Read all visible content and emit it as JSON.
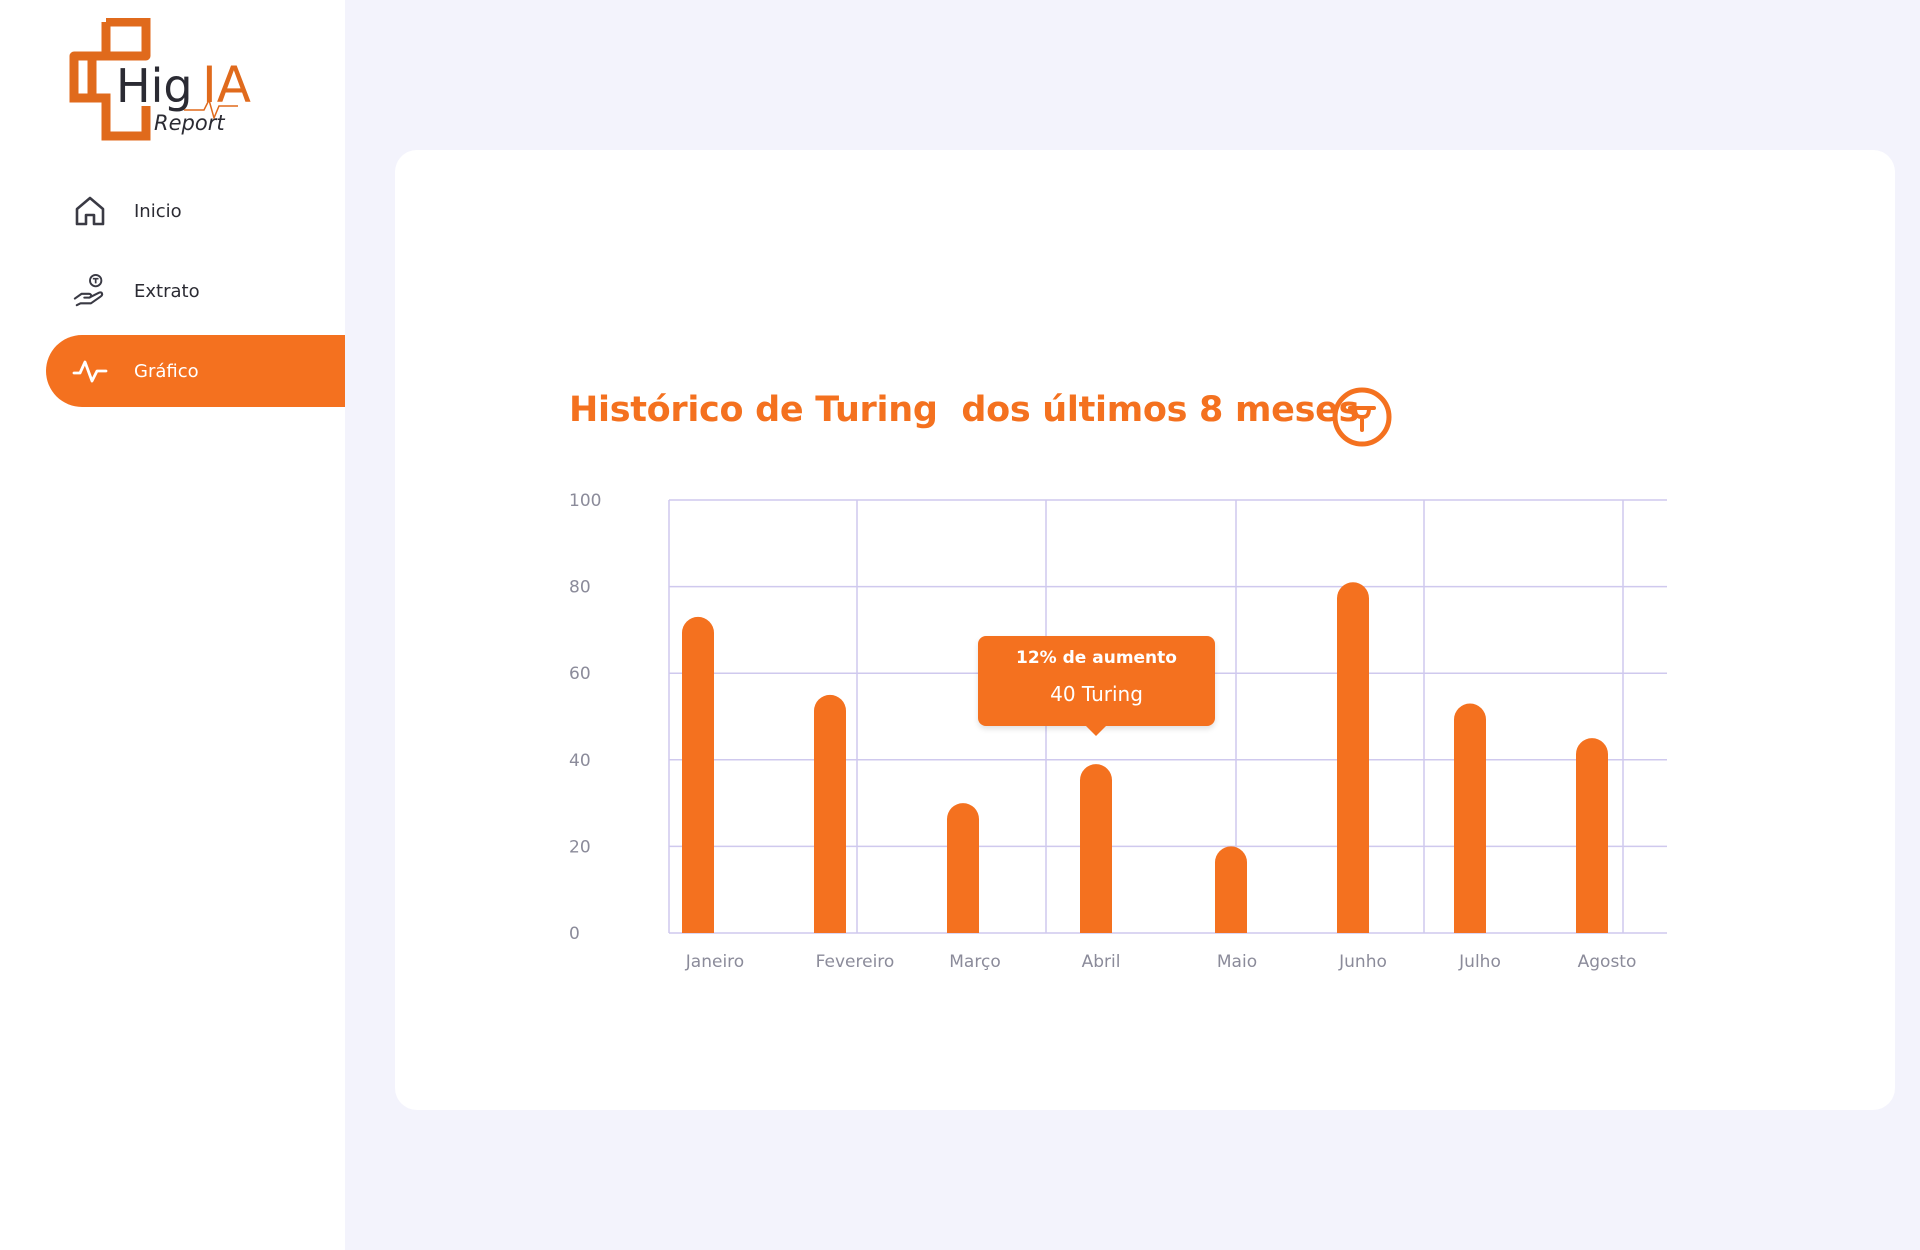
{
  "sidebar": {
    "logo": {
      "brand_hig": "Hig",
      "brand_ia": "IA",
      "subtitle": "Report"
    },
    "items": [
      {
        "label": "Inicio",
        "icon": "home-icon"
      },
      {
        "label": "Extrato",
        "icon": "hand-coin-icon"
      },
      {
        "label": "Gráfico",
        "icon": "activity-icon",
        "active": true
      }
    ]
  },
  "colors": {
    "accent": "#f4711f",
    "background": "#f3f3fc",
    "grid": "#cfc9ee",
    "axis_text": "#8b8b9a"
  },
  "main": {
    "title": "Histórico de Turing  dos últimos 8 meses",
    "title_icon": "turing-coin-icon",
    "tooltip": {
      "line1": "12% de aumento",
      "line2": "40 Turing"
    }
  },
  "chart_data": {
    "type": "bar",
    "categories": [
      "Janeiro",
      "Fevereiro",
      "Março",
      "Abril",
      "Maio",
      "Junho",
      "Julho",
      "Agosto"
    ],
    "values": [
      73,
      55,
      30,
      39,
      20,
      81,
      53,
      45
    ],
    "yticks": [
      0,
      20,
      40,
      60,
      80,
      100
    ],
    "ylim": [
      0,
      100
    ],
    "grid": true,
    "title": "Histórico de Turing  dos últimos 8 meses"
  }
}
